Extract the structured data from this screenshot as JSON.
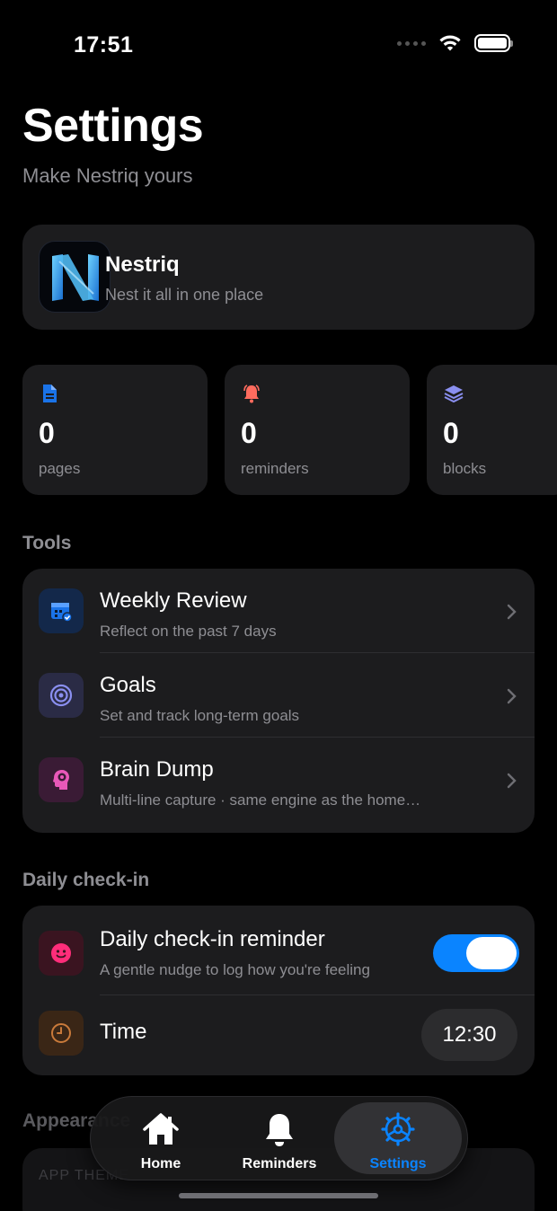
{
  "status_bar": {
    "time": "17:51"
  },
  "header": {
    "title": "Settings",
    "subtitle": "Make Nestriq yours"
  },
  "app_card": {
    "name": "Nestriq",
    "tagline": "Nest it all in one place"
  },
  "stats": [
    {
      "value": "0",
      "label": "pages",
      "icon": "document-icon",
      "color": "#1a73e8"
    },
    {
      "value": "0",
      "label": "reminders",
      "icon": "bell-icon",
      "color": "#ff6b5e"
    },
    {
      "value": "0",
      "label": "blocks",
      "icon": "layers-icon",
      "color": "#8a8ff0"
    }
  ],
  "tools": {
    "label": "Tools",
    "items": [
      {
        "title": "Weekly Review",
        "subtitle": "Reflect on the past 7 days",
        "icon": "calendar-check-icon",
        "color": "#1a73e8"
      },
      {
        "title": "Goals",
        "subtitle": "Set and track long-term goals",
        "icon": "target-icon",
        "color": "#8a8ff0"
      },
      {
        "title": "Brain Dump",
        "subtitle": "Multi-line capture · same engine as the home…",
        "icon": "brain-head-icon",
        "color": "#e858b8"
      }
    ]
  },
  "daily_checkin": {
    "label": "Daily check-in",
    "reminder": {
      "title": "Daily check-in reminder",
      "subtitle": "A gentle nudge to log how you're feeling",
      "enabled": true,
      "icon": "smiley-icon",
      "color": "#ff2d7a"
    },
    "time": {
      "title": "Time",
      "value": "12:30",
      "icon": "clock-icon",
      "color": "#c97a3a"
    }
  },
  "appearance": {
    "label": "Appearance",
    "app_theme_label": "APP THEME"
  },
  "tab_bar": {
    "tabs": [
      {
        "label": "Home",
        "icon": "house-icon",
        "active": false
      },
      {
        "label": "Reminders",
        "icon": "bell-icon",
        "active": false
      },
      {
        "label": "Settings",
        "icon": "gear-icon",
        "active": true
      }
    ],
    "accent": "#0a84ff"
  }
}
